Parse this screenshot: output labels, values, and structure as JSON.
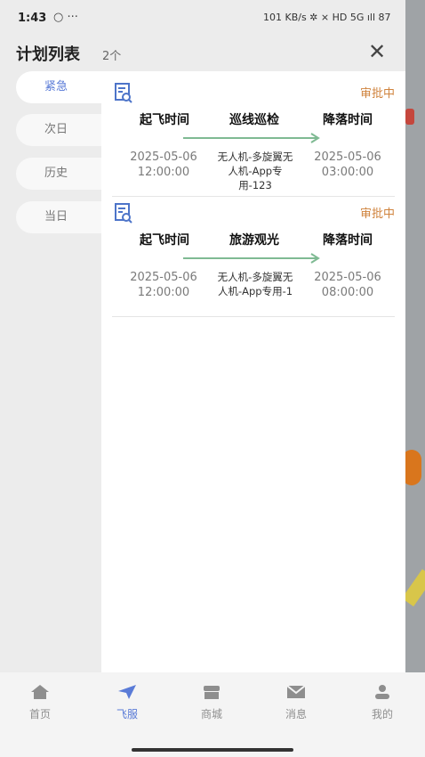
{
  "status": {
    "time": "1:43",
    "message_icon": "○ ···",
    "right": "101 KB/s ✲ ⨯ HD 5G ıll 87"
  },
  "header": {
    "title": "计划列表",
    "count": "2个",
    "close_icon": "close-icon"
  },
  "tabs": [
    {
      "label": "紧急",
      "active": true
    },
    {
      "label": "次日",
      "active": false
    },
    {
      "label": "历史",
      "active": false
    },
    {
      "label": "当日",
      "active": false
    }
  ],
  "plans": [
    {
      "status": "审批中",
      "depart_label": "起飞时间",
      "mission": "巡线巡检",
      "land_label": "降落时间",
      "depart_date": "2025-05-06",
      "depart_time": "12:00:00",
      "aircraft": "无人机-多旋翼无人机-App专用-123",
      "land_date": "2025-05-06",
      "land_time": "03:00:00"
    },
    {
      "status": "审批中",
      "depart_label": "起飞时间",
      "mission": "旅游观光",
      "land_label": "降落时间",
      "depart_date": "2025-05-06",
      "depart_time": "12:00:00",
      "aircraft": "无人机-多旋翼无人机-App专用-1",
      "land_date": "2025-05-06",
      "land_time": "08:00:00"
    }
  ],
  "nav": [
    {
      "label": "首页",
      "icon": "home-icon"
    },
    {
      "label": "飞服",
      "icon": "paper-plane-icon",
      "active": true
    },
    {
      "label": "商城",
      "icon": "shop-icon"
    },
    {
      "label": "消息",
      "icon": "mail-icon"
    },
    {
      "label": "我的",
      "icon": "user-icon"
    }
  ],
  "colors": {
    "accent": "#5a7bd7",
    "approval": "#d0833d",
    "arrow": "#7fba93"
  }
}
